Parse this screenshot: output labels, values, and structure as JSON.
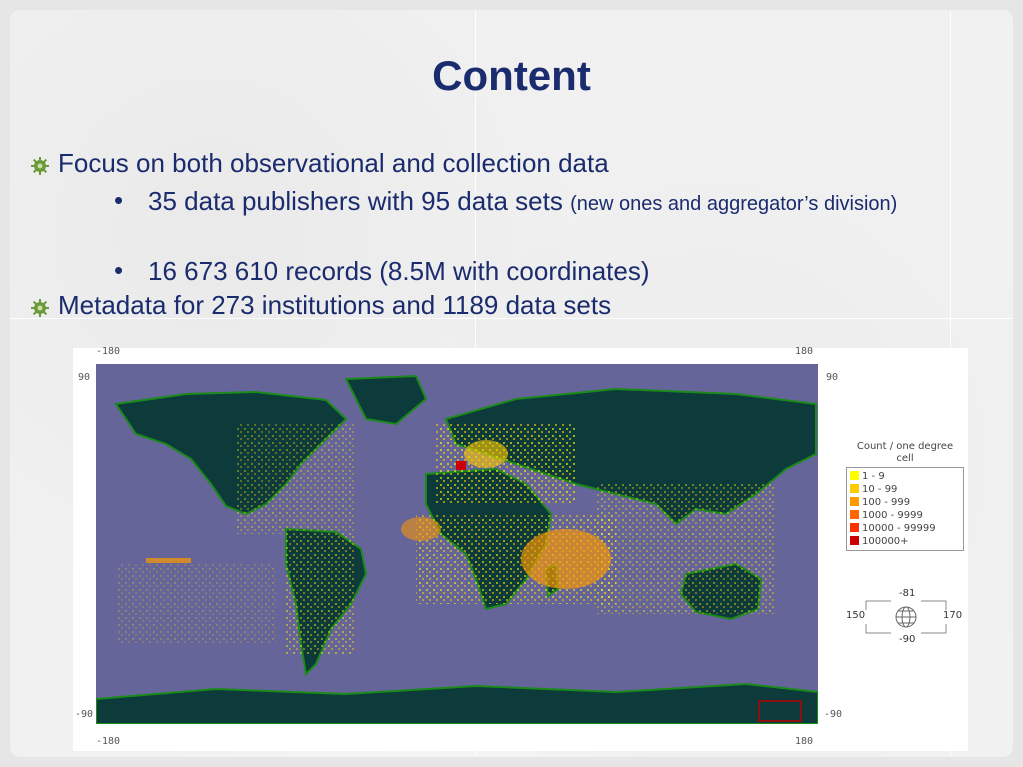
{
  "slide": {
    "title": "Content",
    "bullets": [
      {
        "text": "Focus on both observational and collection data"
      },
      {
        "text": "35 data publishers with 95 data sets",
        "note": "(new ones and aggregator’s division)"
      },
      {
        "text": "16 673 610 records (8.5M with coordinates)"
      },
      {
        "text": "Metadata for 273 institutions and 1189 data sets"
      }
    ]
  },
  "map": {
    "axis": {
      "lon_min": "-180",
      "lon_max": "180",
      "lat_max": "90",
      "lat_min": "-90"
    },
    "colors": {
      "ocean": "#66659a",
      "land": "#0d3a3a",
      "coast": "#1a8a1a"
    },
    "legend": {
      "title_line1": "Count / one degree",
      "title_line2": "cell",
      "items": [
        {
          "label": "1 - 9",
          "color": "#ffff00"
        },
        {
          "label": "10 - 99",
          "color": "#ffcc00"
        },
        {
          "label": "100 - 999",
          "color": "#ff9900"
        },
        {
          "label": "1000 - 9999",
          "color": "#ff6600"
        },
        {
          "label": "10000 - 99999",
          "color": "#ff3300"
        },
        {
          "label": "100000+",
          "color": "#cc0000"
        }
      ]
    },
    "compass": {
      "north": "-81",
      "south": "-90",
      "west": "150",
      "east": "170"
    }
  }
}
